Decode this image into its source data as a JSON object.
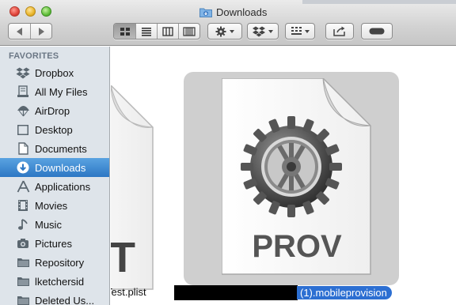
{
  "window": {
    "title": "Downloads",
    "colors": {
      "titlebar": "#d2d2d2",
      "sidebar": "#dee4ea",
      "selection": "#2d77c4"
    }
  },
  "toolbar": {
    "nav": {
      "back_icon": "chevron-left-icon",
      "forward_icon": "chevron-right-icon"
    },
    "view_modes": [
      {
        "icon": "icon-view-icon",
        "active": true
      },
      {
        "icon": "list-view-icon",
        "active": false
      },
      {
        "icon": "column-view-icon",
        "active": false
      },
      {
        "icon": "coverflow-view-icon",
        "active": false
      }
    ],
    "action_icon": "gear-icon",
    "dropbox_icon": "dropbox-icon",
    "arrange_icon": "arrange-grid-icon",
    "share_icon": "share-icon",
    "tag_icon": "tag-toggle-icon"
  },
  "sidebar": {
    "heading": "FAVORITES",
    "items": [
      {
        "label": "Dropbox",
        "icon": "dropbox-icon"
      },
      {
        "label": "All My Files",
        "icon": "all-files-icon"
      },
      {
        "label": "AirDrop",
        "icon": "airdrop-icon"
      },
      {
        "label": "Desktop",
        "icon": "desktop-icon"
      },
      {
        "label": "Documents",
        "icon": "documents-icon"
      },
      {
        "label": "Downloads",
        "icon": "downloads-icon",
        "selected": true
      },
      {
        "label": "Applications",
        "icon": "applications-icon"
      },
      {
        "label": "Movies",
        "icon": "movies-icon"
      },
      {
        "label": "Music",
        "icon": "music-icon"
      },
      {
        "label": "Pictures",
        "icon": "pictures-icon"
      },
      {
        "label": "Repository",
        "icon": "folder-icon"
      },
      {
        "label": "lketchersid",
        "icon": "folder-icon"
      },
      {
        "label": "Deleted Us...",
        "icon": "folder-icon"
      }
    ]
  },
  "files": [
    {
      "name": "Test.plist",
      "icon": "plist-document-icon",
      "big_text": "T"
    },
    {
      "name": "(1).mobileprovision",
      "icon": "mobileprovision-document-icon",
      "big_text": "PROV",
      "selected": true
    }
  ]
}
